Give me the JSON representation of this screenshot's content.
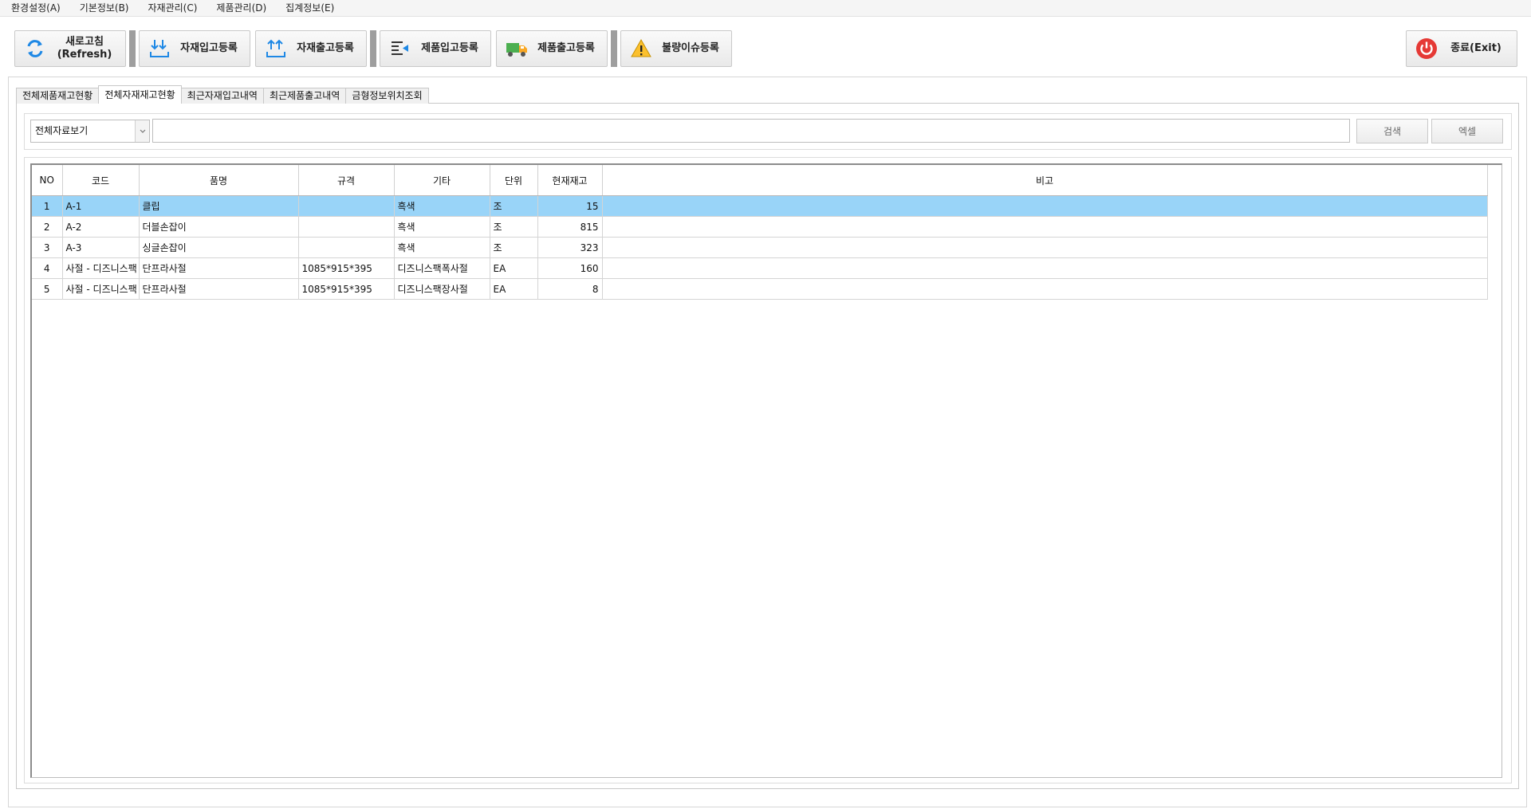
{
  "menu": [
    "환경설정(A)",
    "기본정보(B)",
    "자재관리(C)",
    "제품관리(D)",
    "집계정보(E)"
  ],
  "toolbar": {
    "refresh_line1": "새로고침",
    "refresh_line2": "(Refresh)",
    "material_in": "자재입고등록",
    "material_out": "자재출고등록",
    "product_in": "제품입고등록",
    "product_out": "제품출고등록",
    "defect": "불량이슈등록",
    "exit": "종료(Exit)"
  },
  "tabs": [
    "전체제품재고현황",
    "전체자재재고현황",
    "최근자재입고내역",
    "최근제품출고내역",
    "금형정보위치조회"
  ],
  "active_tab": 1,
  "search": {
    "combo_value": "전체자료보기",
    "input_value": "",
    "search_label": "검색",
    "excel_label": "엑셀"
  },
  "grid": {
    "columns": [
      "NO",
      "코드",
      "품명",
      "규격",
      "기타",
      "단위",
      "현재재고",
      "비고"
    ],
    "rows": [
      {
        "no": "1",
        "code": "A-1",
        "name": "클립",
        "spec": "",
        "etc": "흑색",
        "unit": "조",
        "qty": "15",
        "note": ""
      },
      {
        "no": "2",
        "code": "A-2",
        "name": "더블손잡이",
        "spec": "",
        "etc": "흑색",
        "unit": "조",
        "qty": "815",
        "note": ""
      },
      {
        "no": "3",
        "code": "A-3",
        "name": "싱글손잡이",
        "spec": "",
        "etc": "흑색",
        "unit": "조",
        "qty": "323",
        "note": ""
      },
      {
        "no": "4",
        "code": "사절 - 디즈니스팩",
        "name": "단프라사절",
        "spec": "1085*915*395",
        "etc": "디즈니스팩폭사절",
        "unit": "EA",
        "qty": "160",
        "note": ""
      },
      {
        "no": "5",
        "code": "사절 - 디즈니스팩",
        "name": "단프라사절",
        "spec": "1085*915*395",
        "etc": "디즈니스팩장사절",
        "unit": "EA",
        "qty": "8",
        "note": ""
      }
    ],
    "selected_row": 0
  },
  "colors": {
    "selection": "#99d4f8",
    "refresh_icon": "#1e88e5",
    "truck_icon": "#4caf50",
    "warning_icon": "#fbc02d",
    "exit_icon": "#e53935"
  }
}
